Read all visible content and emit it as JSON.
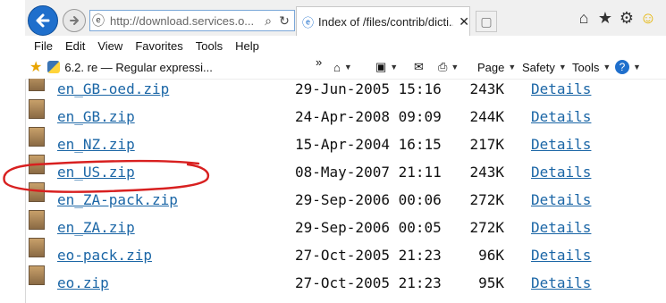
{
  "toolbar": {
    "address": "http://download.services.o...",
    "tab_title": "Index of /files/contrib/dicti...",
    "menu": [
      "File",
      "Edit",
      "View",
      "Favorites",
      "Tools",
      "Help"
    ],
    "favorite": "6.2. re — Regular expressi...",
    "overflow": "»",
    "cmd_page": "Page",
    "cmd_safety": "Safety",
    "cmd_tools": "Tools",
    "cmd_help": "?"
  },
  "files": [
    {
      "name": "en_GB-oed.zip",
      "date": "29-Jun-2005 15:16",
      "size": "243K",
      "details": "Details"
    },
    {
      "name": "en_GB.zip",
      "date": "24-Apr-2008 09:09",
      "size": "244K",
      "details": "Details"
    },
    {
      "name": "en_NZ.zip",
      "date": "15-Apr-2004 16:15",
      "size": "217K",
      "details": "Details"
    },
    {
      "name": "en_US.zip",
      "date": "08-May-2007 21:11",
      "size": "243K",
      "details": "Details"
    },
    {
      "name": "en_ZA-pack.zip",
      "date": "29-Sep-2006 00:06",
      "size": "272K",
      "details": "Details"
    },
    {
      "name": "en_ZA.zip",
      "date": "29-Sep-2006 00:05",
      "size": "272K",
      "details": "Details"
    },
    {
      "name": "eo-pack.zip",
      "date": "27-Oct-2005 21:23",
      "size": "96K",
      "details": "Details"
    },
    {
      "name": "eo.zip",
      "date": "27-Oct-2005 21:23",
      "size": "95K",
      "details": "Details"
    }
  ],
  "annotation": {
    "color": "#d82020",
    "target": "en_US.zip"
  }
}
